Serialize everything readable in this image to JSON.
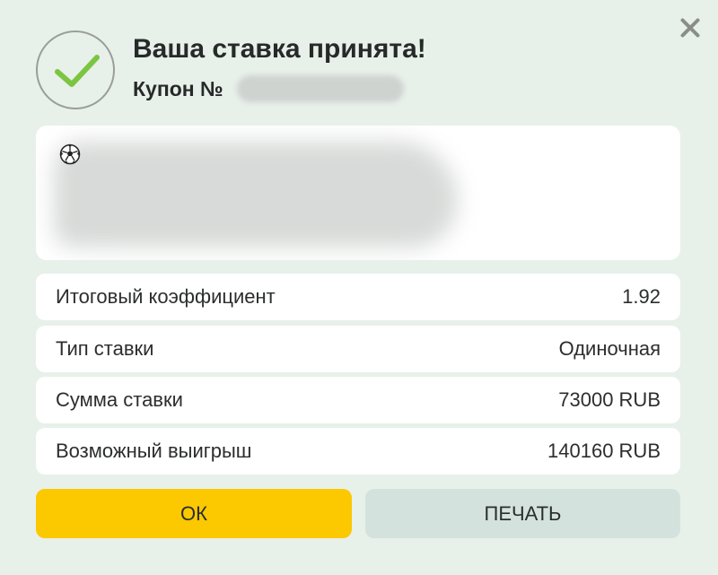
{
  "header": {
    "title": "Ваша ставка принята!",
    "coupon_label": "Купон №"
  },
  "icons": {
    "close": "close-icon",
    "success": "check-icon",
    "sport": "soccer-ball-icon"
  },
  "colors": {
    "background": "#e8f0ea",
    "check": "#7cc540",
    "ok_button": "#fcc800",
    "print_button": "#d3e2dc"
  },
  "details": [
    {
      "label": "Итоговый коэффициент",
      "value": "1.92"
    },
    {
      "label": "Тип ставки",
      "value": "Одиночная"
    },
    {
      "label": "Сумма ставки",
      "value": "73000 RUB"
    },
    {
      "label": "Возможный выигрыш",
      "value": "140160 RUB"
    }
  ],
  "buttons": {
    "ok": "ОК",
    "print": "ПЕЧАТЬ"
  }
}
